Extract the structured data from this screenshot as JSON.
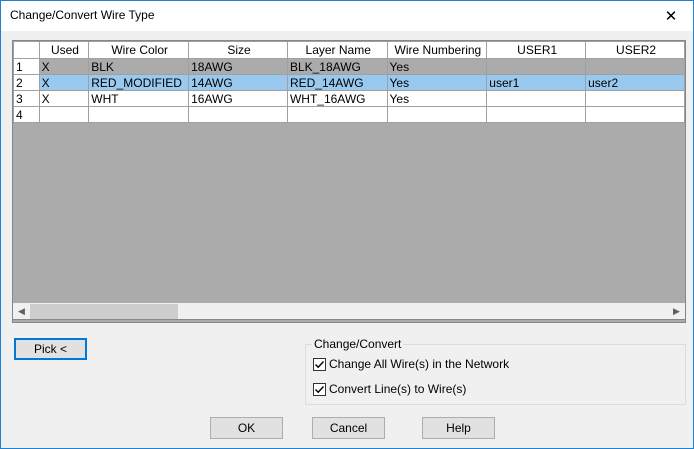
{
  "window": {
    "title": "Change/Convert Wire Type",
    "close_glyph": "✕"
  },
  "grid": {
    "columns": [
      "Used",
      "Wire Color",
      "Size",
      "Layer Name",
      "Wire Numbering",
      "USER1",
      "USER2"
    ],
    "rows": [
      {
        "num": "1",
        "cells": [
          "X",
          "BLK",
          "18AWG",
          "BLK_18AWG",
          "Yes",
          "",
          ""
        ]
      },
      {
        "num": "2",
        "cells": [
          "X",
          "RED_MODIFIED",
          "14AWG",
          "RED_14AWG",
          "Yes",
          "user1",
          "user2"
        ]
      },
      {
        "num": "3",
        "cells": [
          "X",
          "WHT",
          "16AWG",
          "WHT_16AWG",
          "Yes",
          "",
          ""
        ]
      },
      {
        "num": "4",
        "cells": [
          "",
          "",
          "",
          "",
          "",
          "",
          ""
        ]
      }
    ]
  },
  "scrollbar": {
    "left_arrow": "◀",
    "right_arrow": "▶"
  },
  "buttons": {
    "pick": "Pick <",
    "ok": "OK",
    "cancel": "Cancel",
    "help": "Help"
  },
  "change_convert": {
    "legend": "Change/Convert",
    "change_all_label": "Change All Wire(s) in the Network",
    "change_all_checked": true,
    "convert_lines_label": "Convert Line(s) to Wire(s)",
    "convert_lines_checked": true
  },
  "colors": {
    "selected_row": "#99c9ef",
    "gray_row": "#ababab",
    "accent": "#0078d7"
  }
}
